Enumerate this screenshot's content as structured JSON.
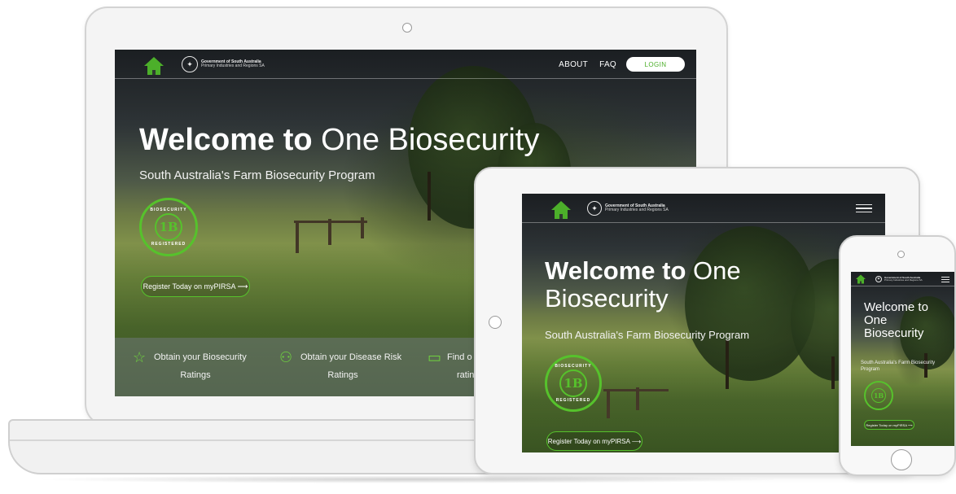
{
  "site": {
    "gov_line1": "Government of South Australia",
    "gov_line2": "Primary Industries and Regions SA"
  },
  "laptop": {
    "nav": {
      "about": "ABOUT",
      "faq": "FAQ",
      "login": "LOGIN"
    },
    "hero": {
      "title_bold": "Welcome to",
      "title_light": "One Biosecurity",
      "subtitle": "South Australia's Farm Biosecurity Program"
    },
    "badge": {
      "mark": "1B",
      "ring_top": "BIOSECURITY",
      "ring_bottom": "REGISTERED"
    },
    "register_button": "Register Today on myPIRSA ⟶",
    "features": [
      {
        "icon": "star-icon",
        "line1": "Obtain your Biosecurity",
        "line2": "Ratings"
      },
      {
        "icon": "disease-icon",
        "line1": "Obtain your Disease Risk",
        "line2": "Ratings"
      },
      {
        "icon": "screen-icon",
        "line1": "Find o",
        "line2": "ratings prior to"
      }
    ]
  },
  "tablet": {
    "hero": {
      "title_bold": "Welcome to",
      "title_light": "One",
      "title_light_2": "Biosecurity",
      "subtitle": "South Australia's Farm Biosecurity Program"
    },
    "badge": {
      "mark": "1B",
      "ring_top": "BIOSECURITY",
      "ring_bottom": "REGISTERED"
    },
    "register_button": "Register Today on myPIRSA ⟶"
  },
  "phone": {
    "hero": {
      "title_line1": "Welcome to",
      "title_line2": "One",
      "title_line3": "Biosecurity",
      "subtitle": "South Australia's Farm Biosecurity Program"
    },
    "badge": {
      "mark": "1B"
    },
    "register_button": "Register Today on myPIRSA ⟶"
  },
  "colors": {
    "brand_green": "#56c22c",
    "home_green": "#4caf2a",
    "device_frame": "#f4f4f4"
  }
}
